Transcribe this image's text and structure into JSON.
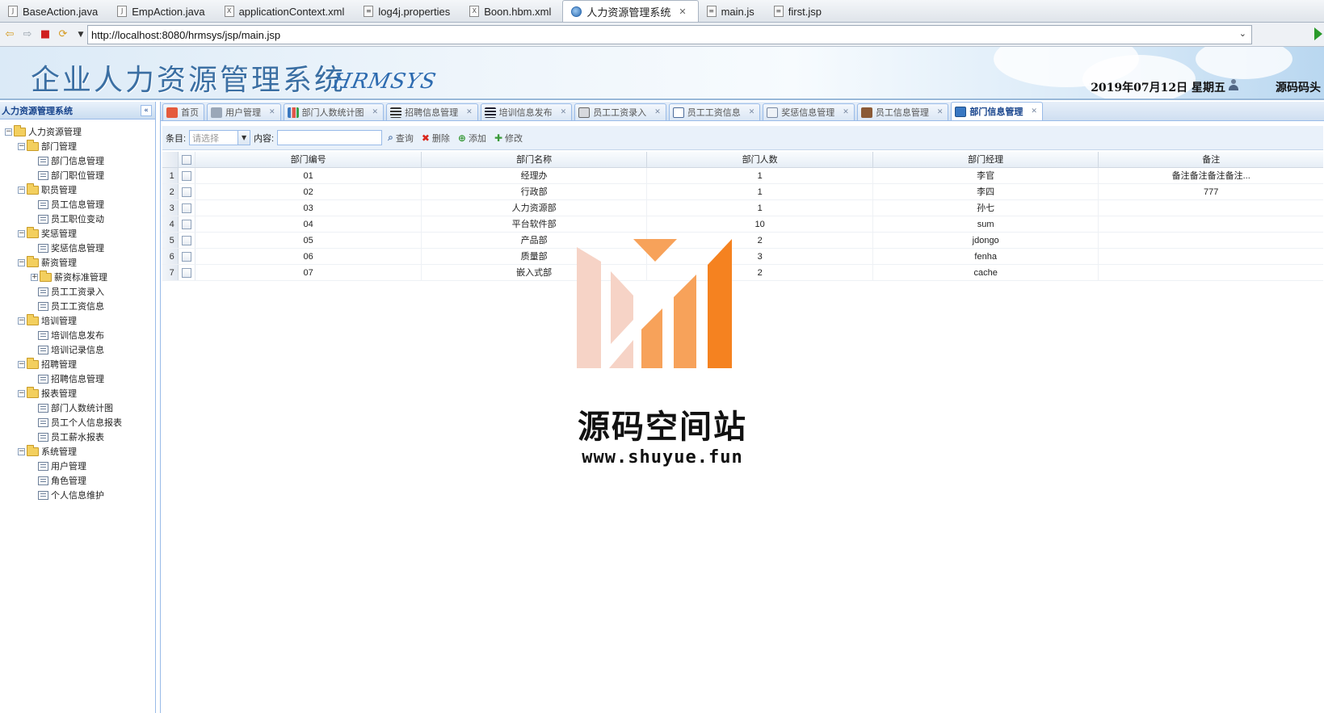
{
  "editor_tabs": [
    {
      "label": "BaseAction.java",
      "icon": "java-file-icon"
    },
    {
      "label": "EmpAction.java",
      "icon": "java-file-icon"
    },
    {
      "label": "applicationContext.xml",
      "icon": "xml-file-icon"
    },
    {
      "label": "log4j.properties",
      "icon": "properties-file-icon"
    },
    {
      "label": "Boon.hbm.xml",
      "icon": "xml-file-icon"
    },
    {
      "label": "人力资源管理系统",
      "icon": "globe-icon",
      "active": true
    },
    {
      "label": "main.js",
      "icon": "js-file-icon"
    },
    {
      "label": "first.jsp",
      "icon": "jsp-file-icon"
    }
  ],
  "browser": {
    "url": "http://localhost:8080/hrmsys/jsp/main.jsp"
  },
  "banner": {
    "title": "企业人力资源管理系统",
    "subtitle": "HRMSYS",
    "date": "2019年07月12日 星期五",
    "user": "源码码头"
  },
  "sidebar": {
    "title": "人力资源管理系统",
    "tree": [
      {
        "label": "人力资源管理",
        "level": 0,
        "type": "folder",
        "toggle": "−"
      },
      {
        "label": "部门管理",
        "level": 1,
        "type": "folder",
        "toggle": "−"
      },
      {
        "label": "部门信息管理",
        "level": 2,
        "type": "leaf"
      },
      {
        "label": "部门职位管理",
        "level": 2,
        "type": "leaf"
      },
      {
        "label": "职员管理",
        "level": 1,
        "type": "folder",
        "toggle": "−"
      },
      {
        "label": "员工信息管理",
        "level": 2,
        "type": "leaf"
      },
      {
        "label": "员工职位变动",
        "level": 2,
        "type": "leaf"
      },
      {
        "label": "奖惩管理",
        "level": 1,
        "type": "folder",
        "toggle": "−"
      },
      {
        "label": "奖惩信息管理",
        "level": 2,
        "type": "leaf"
      },
      {
        "label": "薪资管理",
        "level": 1,
        "type": "folder",
        "toggle": "−"
      },
      {
        "label": "薪资标准管理",
        "level": 2,
        "type": "folder",
        "toggle": "+"
      },
      {
        "label": "员工工资录入",
        "level": 2,
        "type": "leaf"
      },
      {
        "label": "员工工资信息",
        "level": 2,
        "type": "leaf"
      },
      {
        "label": "培训管理",
        "level": 1,
        "type": "folder",
        "toggle": "−"
      },
      {
        "label": "培训信息发布",
        "level": 2,
        "type": "leaf"
      },
      {
        "label": "培训记录信息",
        "level": 2,
        "type": "leaf"
      },
      {
        "label": "招聘管理",
        "level": 1,
        "type": "folder",
        "toggle": "−"
      },
      {
        "label": "招聘信息管理",
        "level": 2,
        "type": "leaf"
      },
      {
        "label": "报表管理",
        "level": 1,
        "type": "folder",
        "toggle": "−"
      },
      {
        "label": "部门人数统计图",
        "level": 2,
        "type": "leaf"
      },
      {
        "label": "员工个人信息报表",
        "level": 2,
        "type": "leaf"
      },
      {
        "label": "员工薪水报表",
        "level": 2,
        "type": "leaf"
      },
      {
        "label": "系统管理",
        "level": 1,
        "type": "folder",
        "toggle": "−"
      },
      {
        "label": "用户管理",
        "level": 2,
        "type": "leaf"
      },
      {
        "label": "角色管理",
        "level": 2,
        "type": "leaf"
      },
      {
        "label": "个人信息维护",
        "level": 2,
        "type": "leaf"
      }
    ]
  },
  "page_tabs": [
    {
      "label": "首页",
      "icon": "home-icon",
      "closable": false
    },
    {
      "label": "用户管理",
      "icon": "user-icon",
      "closable": true
    },
    {
      "label": "部门人数统计图",
      "icon": "chart-icon",
      "closable": true
    },
    {
      "label": "招聘信息管理",
      "icon": "list-icon",
      "closable": true
    },
    {
      "label": "培训信息发布",
      "icon": "news-icon",
      "closable": true
    },
    {
      "label": "员工工资录入",
      "icon": "edit-icon",
      "closable": true
    },
    {
      "label": "员工工资信息",
      "icon": "table-icon",
      "closable": true
    },
    {
      "label": "奖惩信息管理",
      "icon": "report-icon",
      "closable": true
    },
    {
      "label": "员工信息管理",
      "icon": "person-icon",
      "closable": true
    },
    {
      "label": "部门信息管理",
      "icon": "window-icon",
      "closable": true,
      "active": true
    }
  ],
  "toolbar": {
    "field_label": "条目:",
    "field_placeholder": "请选择",
    "content_label": "内容:",
    "content_value": "",
    "search_label": "查询",
    "delete_label": "删除",
    "add_label": "添加",
    "edit_label": "修改"
  },
  "grid": {
    "columns": [
      "部门编号",
      "部门名称",
      "部门人数",
      "部门经理",
      "备注"
    ],
    "rows": [
      {
        "num": "1",
        "cells": [
          "01",
          "经理办",
          "1",
          "李官",
          "备注备注备注备注..."
        ]
      },
      {
        "num": "2",
        "cells": [
          "02",
          "行政部",
          "1",
          "李四",
          "777"
        ]
      },
      {
        "num": "3",
        "cells": [
          "03",
          "人力资源部",
          "1",
          "孙七",
          ""
        ]
      },
      {
        "num": "4",
        "cells": [
          "04",
          "平台软件部",
          "10",
          "sum",
          ""
        ]
      },
      {
        "num": "5",
        "cells": [
          "05",
          "产品部",
          "2",
          "jdongo",
          ""
        ]
      },
      {
        "num": "6",
        "cells": [
          "06",
          "质量部",
          "3",
          "fenha",
          ""
        ]
      },
      {
        "num": "7",
        "cells": [
          "07",
          "嵌入式部",
          "2",
          "cache",
          ""
        ]
      }
    ]
  },
  "watermark": {
    "name": "源码空间站",
    "url": "www.shuyue.fun",
    "colors": {
      "light": "#f6d3c6",
      "mid": "#f7a25a",
      "dark": "#f58220"
    }
  }
}
